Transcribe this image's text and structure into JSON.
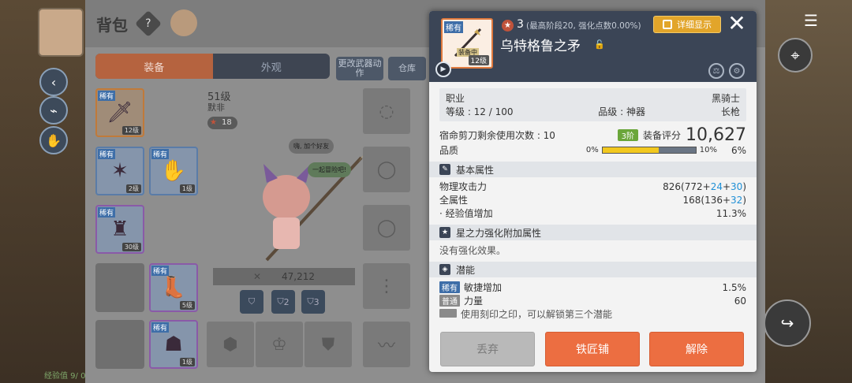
{
  "bg": {
    "hud_left_text": "经验值 9/ 0"
  },
  "inventory": {
    "title": "背包",
    "help": "?",
    "tabs": [
      "装备",
      "外观"
    ],
    "buttons": [
      "更改武器动作",
      "仓库"
    ],
    "character": {
      "level": "51级",
      "name": "默非",
      "stars": "18"
    },
    "bubbles": [
      "嗨, 加个好友",
      "一起冒险吧!"
    ],
    "power": "47,212",
    "presets": [
      "",
      "2",
      "3"
    ],
    "slots": [
      {
        "rare": "稀有",
        "lv": "12级",
        "glyph": "🗡"
      },
      {
        "rare": "稀有",
        "lv": "2级",
        "glyph": "✶"
      },
      {
        "rare": "稀有",
        "lv": "1级",
        "glyph": "✋"
      },
      {
        "rare": "稀有",
        "lv": "30级",
        "glyph": "♜"
      },
      {
        "rare": "稀有",
        "lv": "5级",
        "glyph": "👢"
      },
      {
        "rare": "稀有",
        "lv": "1级",
        "glyph": "☗"
      }
    ]
  },
  "tooltip": {
    "icon": {
      "rare": "稀有",
      "lv": "12级",
      "badge": "装备中"
    },
    "stars": "3",
    "star_note": "(最高阶段20, 强化点数0.00%)",
    "item_name": "乌特格鲁之矛",
    "detail_btn": "详细显示",
    "close": "✕",
    "info": {
      "job_label": "职业",
      "job_value": "黑骑士",
      "level_label": "等级 : 12 / 100",
      "grade_label": "品级 : 神器",
      "weapon_type": "长枪"
    },
    "scissors_label": "宿命剪刀剩余使用次数 : 10",
    "tier": "3阶",
    "score_label": "装备评分",
    "score": "10,627",
    "quality_label": "品质",
    "quality_min": "0%",
    "quality_max": "10%",
    "quality_value": "6%",
    "quality_fill_ratio": 0.6,
    "sections": {
      "basic": "基本属性",
      "star": "星之力强化附加属性",
      "potential": "潜能"
    },
    "basic_stats": [
      {
        "label": "物理攻击力",
        "base": "826(772+",
        "a": "24",
        "plus": "+",
        "b": "30",
        "end": ")"
      },
      {
        "label": "全属性",
        "base": "168(136+",
        "a": "32",
        "plus": "",
        "b": "",
        "end": ")"
      },
      {
        "label": "· 经验值增加",
        "base": "11.3%",
        "a": "",
        "plus": "",
        "b": "",
        "end": ""
      }
    ],
    "no_enhance": "没有强化效果。",
    "potentials": [
      {
        "tag": "稀有",
        "tag_color": "#3e6ea8",
        "label": "敏捷增加",
        "value": "1.5%"
      },
      {
        "tag": "普通",
        "tag_color": "#8a8a8a",
        "label": "力量",
        "value": "60"
      },
      {
        "tag": "",
        "tag_color": "#8a8a8a",
        "label": "使用刻印之印，可以解锁第三个潜能",
        "value": ""
      }
    ],
    "actions": [
      "丢弃",
      "铁匠铺",
      "解除"
    ]
  }
}
